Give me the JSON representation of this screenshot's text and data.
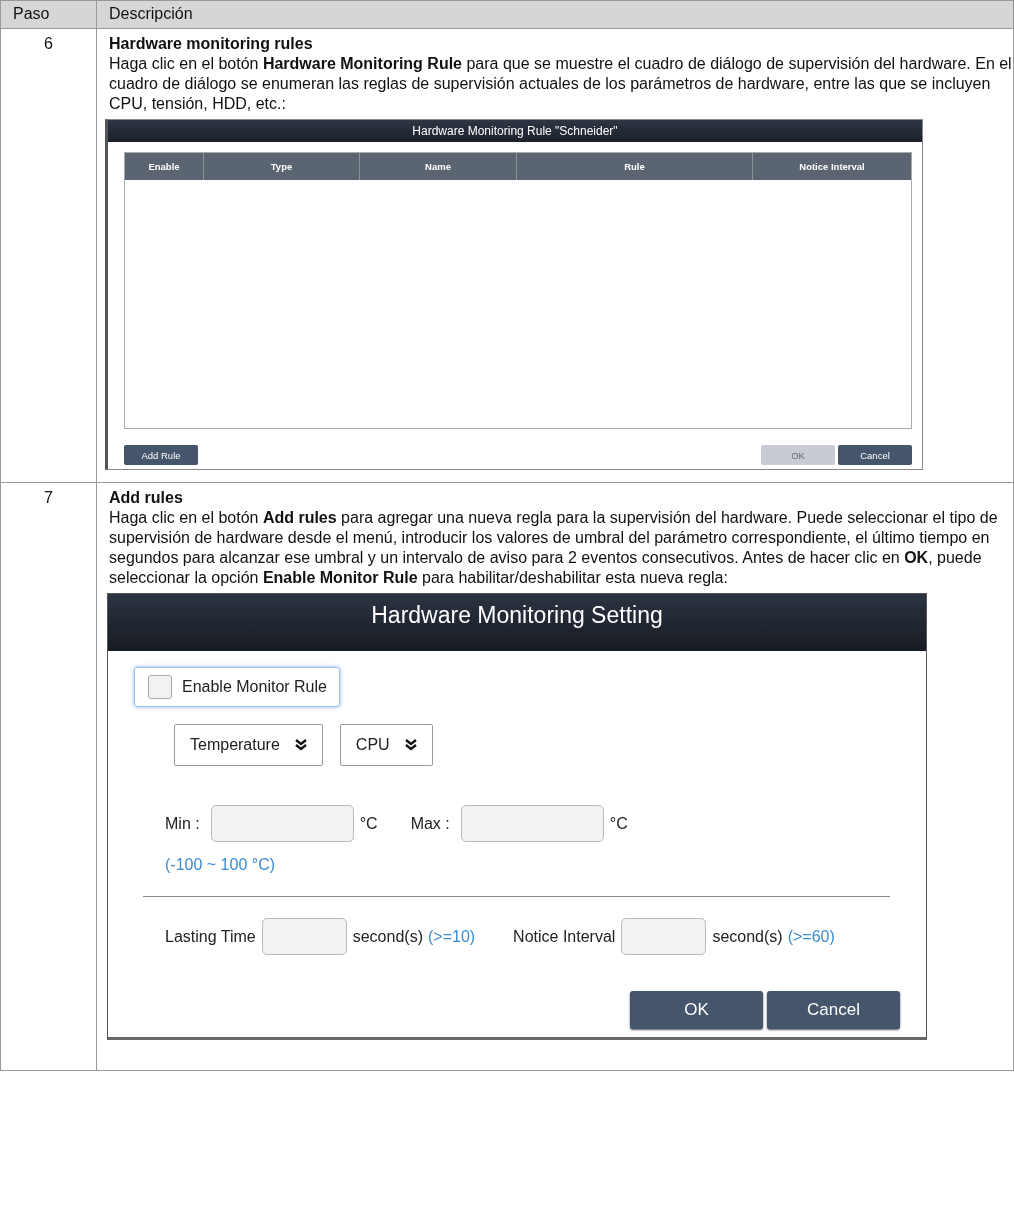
{
  "table": {
    "columns": [
      "Paso",
      "Descripción"
    ],
    "rows": [
      {
        "step": "6",
        "title": "Hardware monitoring rules",
        "text": "Haga clic en el botón **Hardware Monitoring Rule** para que se muestre el cuadro de diálogo de supervisión del hardware. En el cuadro de diálogo se enumeran las reglas de supervisión actuales de los parámetros de hardware, entre las que se incluyen CPU, tensión, HDD, etc.:",
        "figure": {
          "kind": "rule_list",
          "title": "Hardware Monitoring Rule \"Schneider\"",
          "columns": [
            "Enable",
            "Type",
            "Name",
            "Rule",
            "Notice Interval"
          ],
          "add_button": "Add Rule",
          "buttons": [
            {
              "label": "OK",
              "disabled": true
            },
            {
              "label": "Cancel",
              "disabled": false
            }
          ]
        }
      },
      {
        "step": "7",
        "title": "Add rules",
        "text": "Haga clic en el botón **Add rules** para agregar una nueva regla para la supervisión del hardware. Puede seleccionar el tipo de supervisión de hardware desde el menú, introducir los valores de umbral del parámetro correspondiente, el último tiempo en segundos para alcanzar ese umbral y un intervalo de aviso para 2 eventos consecutivos. Antes de hacer clic en **OK**, puede seleccionar la opción **Enable Monitor Rule** para habilitar/deshabilitar esta nueva regla:",
        "figure": {
          "kind": "setting",
          "title": "Hardware Monitoring Setting",
          "enable": {
            "label": "Enable Monitor Rule",
            "checked": false
          },
          "dropdowns": [
            "Temperature",
            "CPU"
          ],
          "min": {
            "label": "Min :",
            "unit": "°C"
          },
          "max": {
            "label": "Max :",
            "unit": "°C"
          },
          "range": "(-100 ~ 100 °C)",
          "lasting": {
            "label": "Lasting Time",
            "unit": "second(s)",
            "hint": "(>=10)"
          },
          "notice": {
            "label": "Notice Interval",
            "unit": "second(s)",
            "hint": "(>=60)"
          },
          "buttons": [
            {
              "label": "OK",
              "disabled": false
            },
            {
              "label": "Cancel",
              "disabled": false
            }
          ]
        }
      }
    ]
  }
}
